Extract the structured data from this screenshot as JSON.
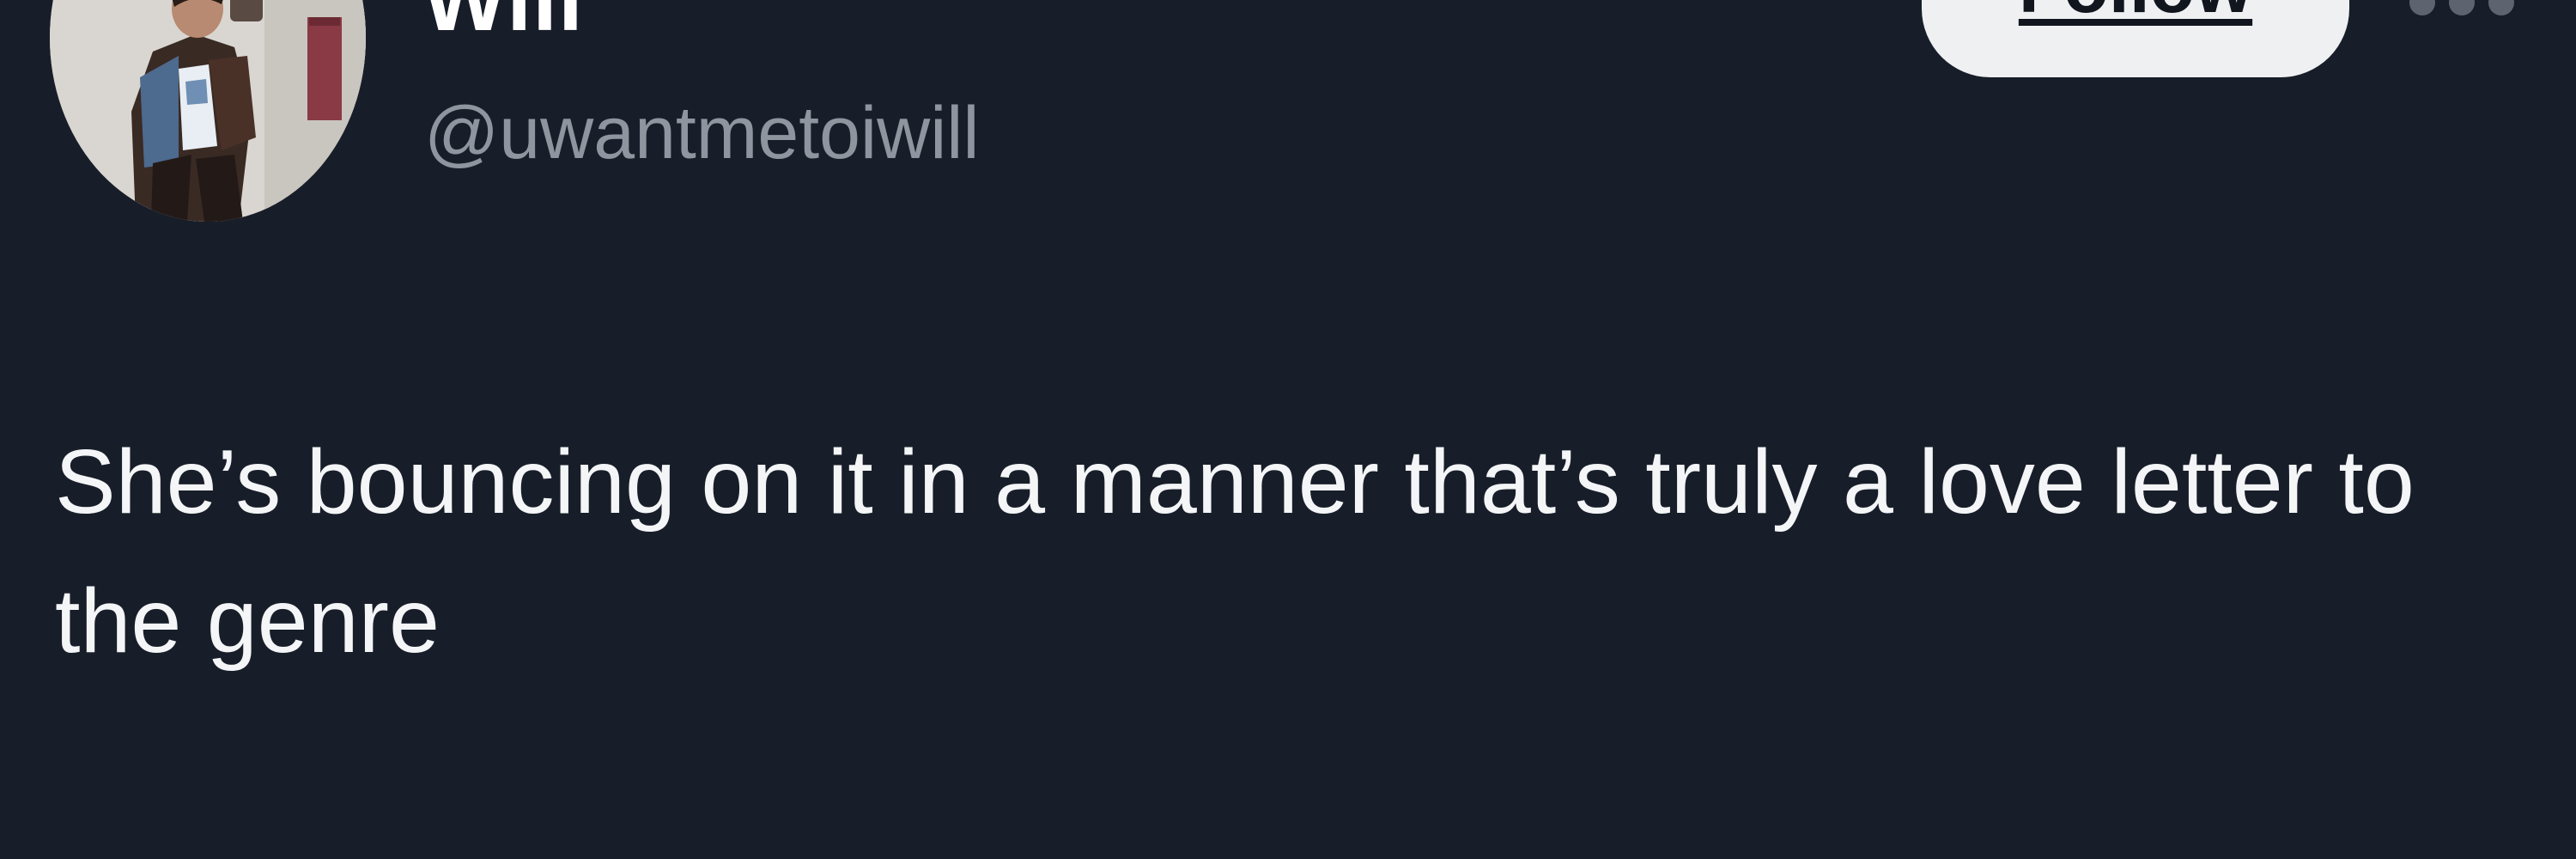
{
  "tweet": {
    "author": {
      "display_name": "Will",
      "handle": "@uwantmetoiwill",
      "avatar_icon": "profile-photo"
    },
    "follow_label": "Follow",
    "more_icon": "more-dots-icon",
    "text": "She’s bouncing on it in a manner that’s truly a love letter to the genre"
  },
  "colors": {
    "background": "#181e29",
    "text": "#f4f5f7",
    "handle": "#8e959f",
    "follow_button_bg": "#eef0f2",
    "follow_button_text": "#11151d"
  }
}
